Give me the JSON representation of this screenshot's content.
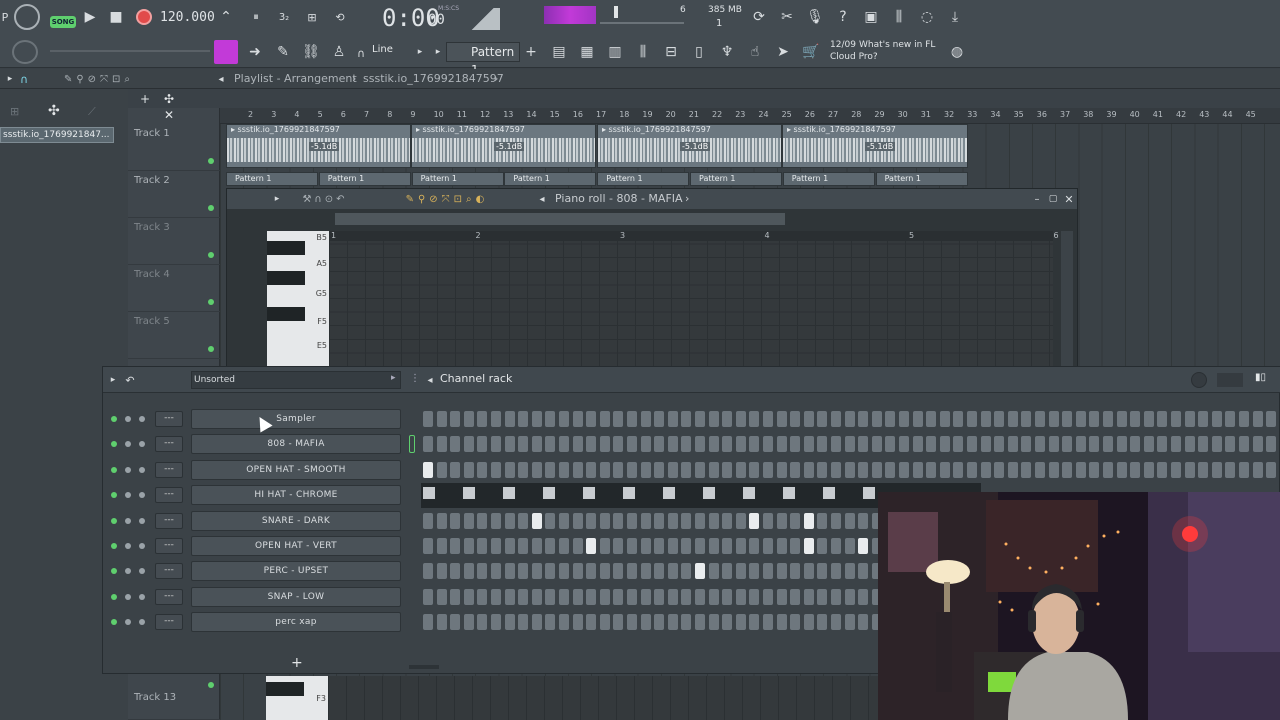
{
  "toolbar": {
    "song_badge": "SONG",
    "tempo": "120.000",
    "time": "0:00",
    "time_sub": "00",
    "time_unit": "M:S:CS",
    "pattern_label": "Pattern 1",
    "line_label": "Line",
    "cpu_count": "6",
    "memory": "385 MB",
    "memory_sub": "1",
    "news_date": "12/09",
    "news_text": "What's new in FL Cloud Pro?",
    "news_line1": "What's new in FL",
    "news_line2": "Cloud Pro?",
    "colors": {
      "bg": "#434b51",
      "accent_purple": "#c23ad8",
      "song_green": "#5fcf6e",
      "record_red": "#e14b4b"
    }
  },
  "playlist": {
    "title": "Playlist - Arrangement",
    "breadcrumb": "ssstik.io_1769921847597",
    "left_item": "ssstik.io_1769921847...",
    "tracks": [
      {
        "label": "Track 1"
      },
      {
        "label": "Track 2"
      },
      {
        "label": "Track 3"
      },
      {
        "label": "Track 4"
      },
      {
        "label": "Track 5"
      }
    ],
    "track_bottom": "Track 13",
    "ruler": [
      "2",
      "3",
      "4",
      "5",
      "6",
      "7",
      "8",
      "9",
      "10",
      "11",
      "12",
      "13",
      "14",
      "15",
      "16",
      "17",
      "18",
      "19",
      "20",
      "21",
      "22",
      "23",
      "24",
      "25",
      "26",
      "27",
      "28",
      "29",
      "30",
      "31",
      "32",
      "33",
      "34",
      "35",
      "36",
      "37",
      "38",
      "39",
      "40",
      "41",
      "42",
      "43",
      "44",
      "45"
    ],
    "audio_clips": [
      {
        "name": "ssstik.io_1769921847597",
        "db": "-5.1dB"
      },
      {
        "name": "ssstik.io_1769921847597",
        "db": "-5.1dB"
      },
      {
        "name": "ssstik.io_1769921847597",
        "db": "-5.1dB"
      },
      {
        "name": "ssstik.io_1769921847597",
        "db": "-5.1dB"
      }
    ],
    "pattern_clips": [
      "Pattern 1",
      "Pattern 1",
      "Pattern 1",
      "Pattern 1",
      "Pattern 1",
      "Pattern 1",
      "Pattern 1",
      "Pattern 1"
    ]
  },
  "piano_roll": {
    "title": "Piano roll - 808 - MAFIA",
    "bars": [
      "1",
      "2",
      "3",
      "4",
      "5",
      "6"
    ],
    "keys": [
      "B5",
      "A5",
      "G5",
      "F5",
      "E5"
    ],
    "bottom_key": "F3"
  },
  "channel_rack": {
    "filter": "Unsorted",
    "title": "Channel rack",
    "channels": [
      {
        "name": "Sampler",
        "steps": []
      },
      {
        "name": "808 - MAFIA",
        "steps": []
      },
      {
        "name": "OPEN HAT - SMOOTH",
        "steps": [
          0
        ]
      },
      {
        "name": "HI HAT - CHROME",
        "steps": []
      },
      {
        "name": "SNARE - DARK",
        "steps": [
          8,
          24,
          28
        ]
      },
      {
        "name": "OPEN HAT - VERT",
        "steps": [
          12,
          28,
          32
        ]
      },
      {
        "name": "PERC - UPSET",
        "steps": [
          20
        ]
      },
      {
        "name": "SNAP - LOW",
        "steps": []
      },
      {
        "name": "perc xap",
        "steps": []
      }
    ],
    "add_button": "+",
    "dash_label": "---"
  }
}
